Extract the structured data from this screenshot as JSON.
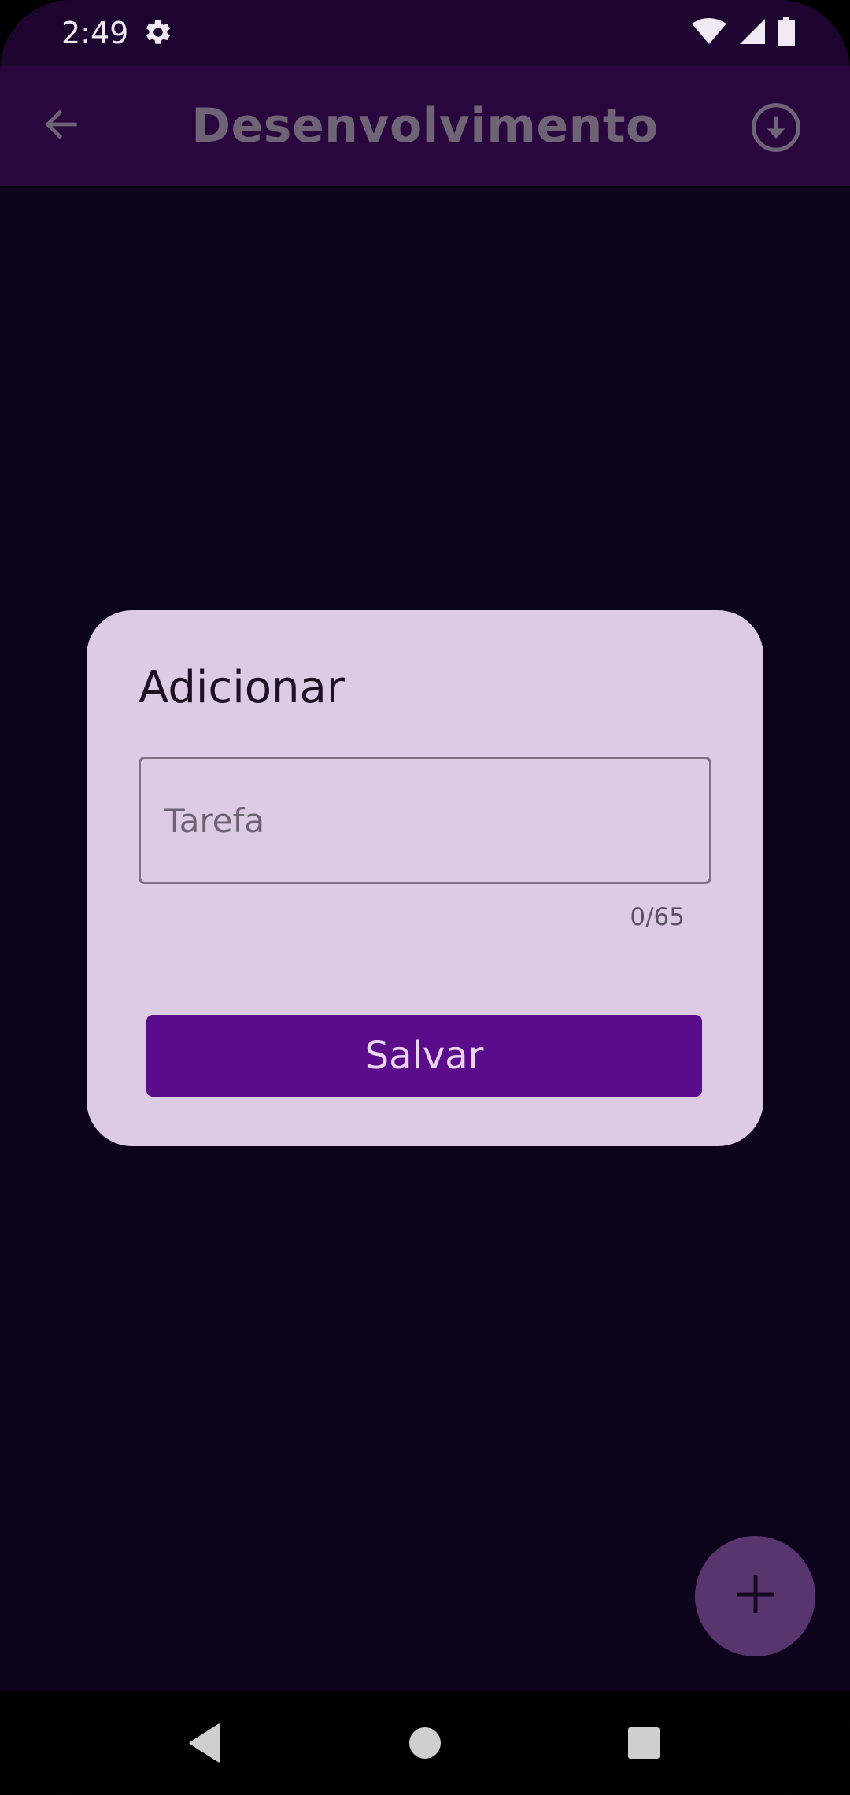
{
  "status_bar": {
    "time": "2:49",
    "icons": [
      "settings-gear-icon",
      "wifi-icon",
      "cellular-signal-icon",
      "battery-icon"
    ]
  },
  "app_bar": {
    "title": "Desenvolvimento",
    "back_icon": "arrow-back-icon",
    "download_icon": "download-circle-icon"
  },
  "dialog": {
    "title": "Adicionar",
    "task_input": {
      "value": "",
      "placeholder": "Tarefa"
    },
    "char_counter": "0/65",
    "save_label": "Salvar"
  },
  "fab": {
    "icon": "plus-icon"
  },
  "nav_bar": {
    "icons": [
      "nav-back-icon",
      "nav-home-icon",
      "nav-recents-icon"
    ]
  },
  "colors": {
    "background": "#0d041c",
    "status_bar": "#1e0530",
    "app_bar": "#2a063f",
    "dialog": "#ddcbe6",
    "save_button": "#5a0c8a",
    "fab": "#593570"
  }
}
